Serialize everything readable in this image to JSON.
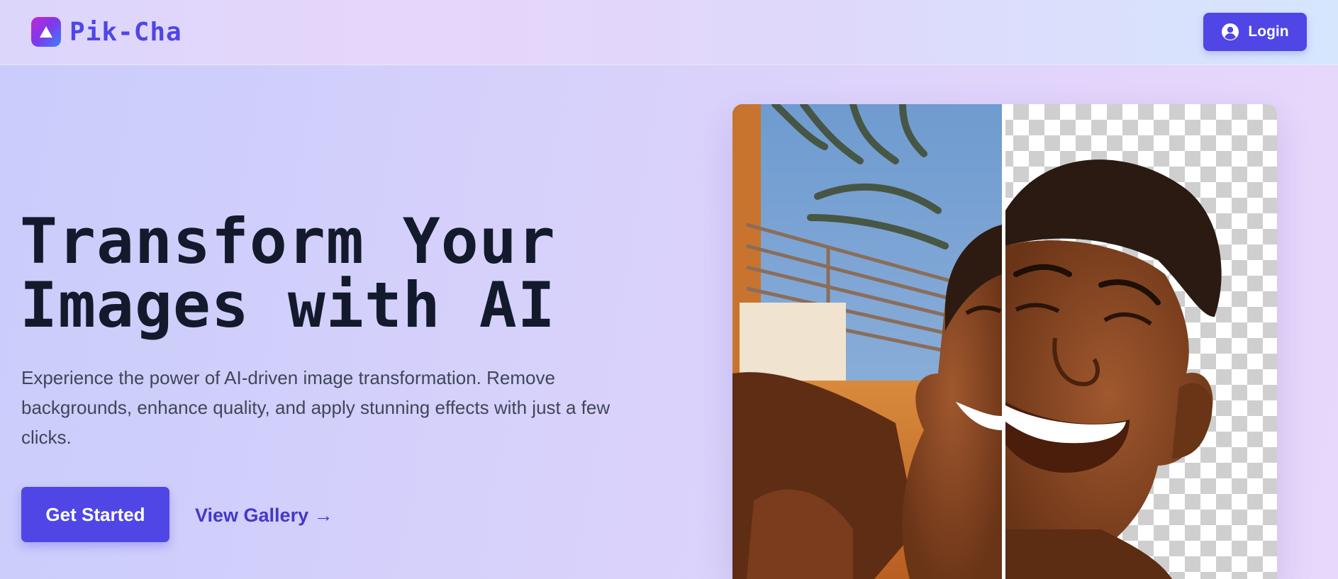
{
  "header": {
    "brand": "Pik-Cha",
    "logo_icon": "triangle-logo-icon",
    "login_label": "Login",
    "login_icon": "user-circle-icon"
  },
  "hero": {
    "title_line1": "Transform Your",
    "title_line2": "Images with AI",
    "description": "Experience the power of AI-driven image transformation. Remove backgrounds, enhance quality, and apply stunning effects with just a few clicks.",
    "primary_cta": "Get Started",
    "secondary_cta": "View Gallery →"
  },
  "comparison": {
    "before_label": "original-photo",
    "after_label": "background-removed-photo"
  },
  "colors": {
    "accent": "#4f46e5",
    "accent_dark": "#4338ca",
    "title": "#131a2c",
    "body_text": "#3f4658"
  }
}
